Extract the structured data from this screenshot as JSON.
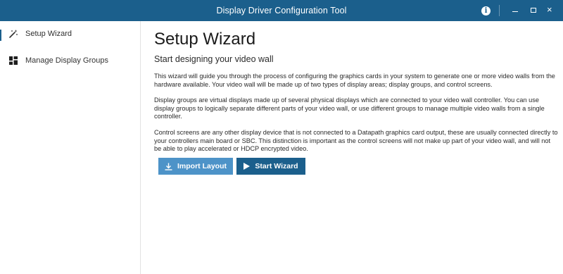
{
  "window": {
    "title": "Display Driver Configuration Tool",
    "controls": {
      "info_glyph": "i",
      "close_glyph": "×"
    }
  },
  "sidebar": {
    "items": [
      {
        "label": "Setup Wizard",
        "icon": "wand-icon",
        "active": true
      },
      {
        "label": "Manage Display Groups",
        "icon": "grid-icon",
        "active": false
      }
    ]
  },
  "main": {
    "title": "Setup Wizard",
    "subtitle": "Start designing your video wall",
    "paragraphs": [
      "This wizard will guide you through the process of configuring the graphics cards in your system to generate one or more video walls from the hardware available. Your video wall will be made up of two types of display areas; display groups, and control screens.",
      "Display groups are virtual displays made up of several physical displays which are connected to your video wall controller. You can use display groups to logically separate different parts of your video wall, or use different groups to manage multiple video walls from a single controller.",
      "Control screens are any other display device that is not connected to a Datapath graphics card output, these are usually connected directly to your controllers main board or SBC. This distinction is important as the control screens will not make up part of your video wall, and will not be able to play accelerated or HDCP encrypted video."
    ],
    "buttons": {
      "import_label": "Import Layout",
      "start_label": "Start Wizard"
    }
  },
  "colors": {
    "titlebar": "#1b5f8c",
    "primary_button": "#1b5f8c",
    "secondary_button": "#4d93c8"
  }
}
